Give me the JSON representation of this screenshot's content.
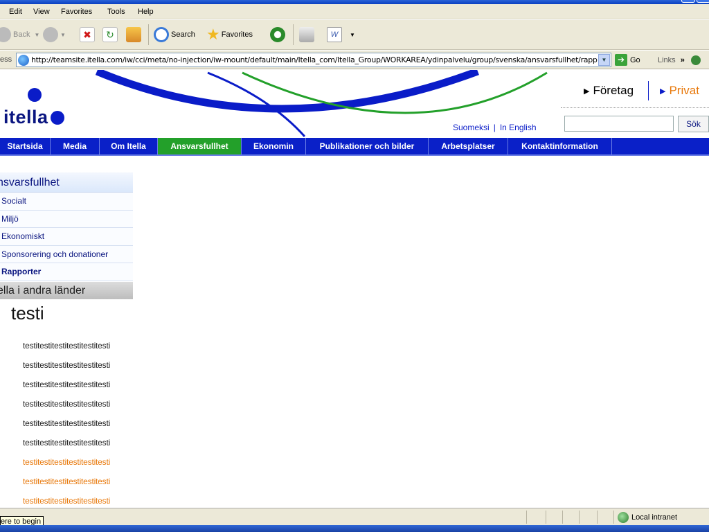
{
  "menubar": {
    "items": [
      "Edit",
      "View",
      "Favorites",
      "Tools",
      "Help"
    ]
  },
  "toolbar": {
    "back_label": "Back",
    "search_label": "Search",
    "favorites_label": "Favorites"
  },
  "addressbar": {
    "label": "ess",
    "url": "http://teamsite.itella.com/iw/cci/meta/no-injection/iw-mount/default/main/Itella_com/Itella_Group/WORKAREA/ydinpalvelu/group/svenska/ansvarsfullhet/rappo",
    "go_label": "Go",
    "links_label": "Links"
  },
  "header": {
    "logo_text": "itella",
    "segment_business": "Företag",
    "segment_private": "Privat",
    "lang_fi": "Suomeksi",
    "lang_separator": "|",
    "lang_en": "In English",
    "search_value": "",
    "search_button": "Sök",
    "colors": {
      "brand_blue": "#0a1cc8",
      "brand_green": "#23a02a",
      "brand_orange": "#e8780a"
    }
  },
  "nav": {
    "items": [
      {
        "label": "Startsida"
      },
      {
        "label": "Media"
      },
      {
        "label": "Om Itella"
      },
      {
        "label": "Ansvarsfullhet",
        "active": true
      },
      {
        "label": "Ekonomin"
      },
      {
        "label": "Publikationer och bilder"
      },
      {
        "label": "Arbetsplatser"
      },
      {
        "label": "Kontaktinformation"
      }
    ]
  },
  "sidebar": {
    "heading": "nsvarsfullhet",
    "items": [
      {
        "label": "Socialt"
      },
      {
        "label": "Miljö"
      },
      {
        "label": "Ekonomiskt"
      },
      {
        "label": "Sponsorering och donationer"
      },
      {
        "label": "Rapporter",
        "active": true
      }
    ],
    "other_heading": "ella i andra länder"
  },
  "content": {
    "title": "testi",
    "lines": [
      {
        "text": "testitestitestitestitestitesti"
      },
      {
        "text": "testitestitestitestitestitesti"
      },
      {
        "text": "testitestitestitestitestitesti"
      },
      {
        "text": "testitestitestitestitestitesti"
      },
      {
        "text": "testitestitestitestitestitesti"
      },
      {
        "text": "testitestitestitestitestitesti"
      },
      {
        "text": "testitestitestitestitestitesti",
        "highlight": true
      },
      {
        "text": "testitestitestitestitestitesti",
        "highlight": true
      },
      {
        "text": "testitestitestitestitestitesti",
        "highlight": true
      }
    ]
  },
  "statusbar": {
    "tooltip": "ere to begin",
    "zone": "Local intranet"
  }
}
